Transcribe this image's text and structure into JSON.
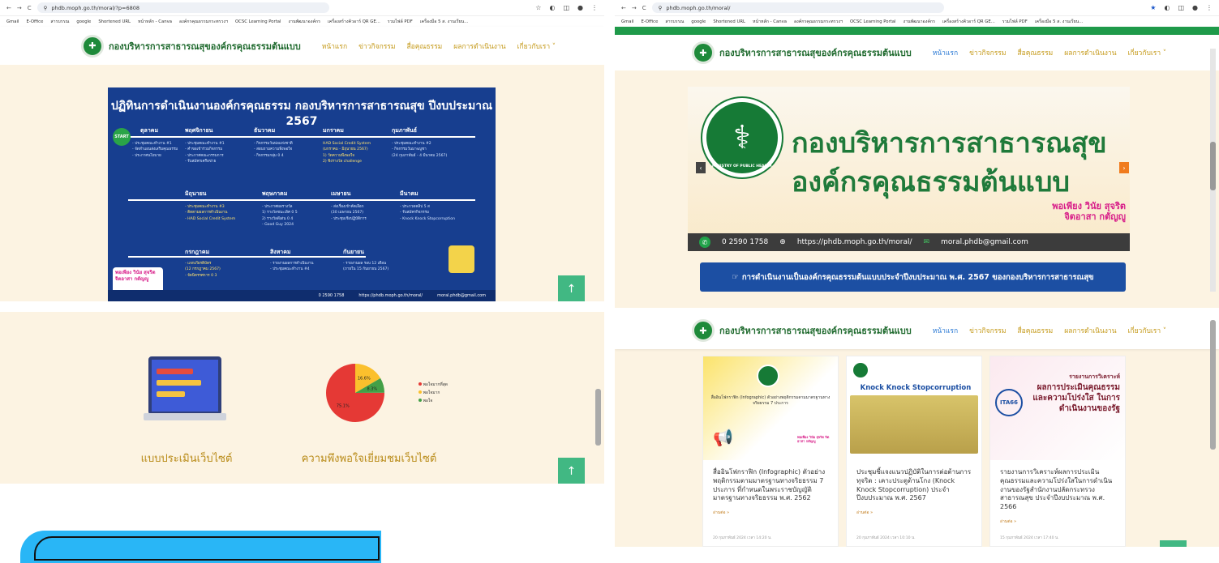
{
  "chrome": {
    "tl_url": "phdb.moph.go.th/moral/?p=6808",
    "tr_url": "phdb.moph.go.th/moral/"
  },
  "bookmarks": [
    "Gmail",
    "E-Office",
    "สารบรรณ",
    "google",
    "Shortened URL",
    "หน้าหลัก - Canva",
    "องค์กรคุณธรรมกระทรวงฯ",
    "OCSC Learning Portal",
    "งานพัฒนาองค์กร",
    "เครื่องสร้างคิวอาร์ QR GE...",
    "รวมไฟล์ PDF",
    "เครื่องมือ 5 ส. งานเรียน..."
  ],
  "brand": "กองบริหารการสาธารณสุของค์กรคุณธรรมต้นแบบ",
  "menu": [
    "หน้าแรก",
    "ข่าวกิจกรรม",
    "สื่อคุณธรรม",
    "ผลการดำเนินงาน",
    "เกี่ยวกับเรา ˅"
  ],
  "poster": {
    "title": "ปฏิทินการดำเนินงานองค์กรคุณธรรม กองบริหารการสาธารณสุข ปีงบประมาณ 2567",
    "start": "START",
    "months": [
      "ตุลาคม",
      "พฤศจิกายน",
      "ธันวาคม",
      "มกราคม",
      "กุมภาพันธ์",
      "มีนาคม",
      "เมษายน",
      "พฤษภาคม",
      "มิถุนายน",
      "สิงหาคม",
      "กรกฎาคม",
      "กันยายน"
    ],
    "lines": [
      "- ประชุมคณะทำงาน #1\n- จัดทำแผนส่งเสริมคุณธรรม\n- ประกาศนโยบาย",
      "- ประชุมคณะทำงาน #1\n- คำขอเข้าร่วมกิจกรรม\n- ประกาศคณะกรรมการ\n- รับสมัครเครือข่าย",
      "- กิจกรรมวันพ่อแห่งชาติ\n- สอบถามความพึงพอใจ\n- กิจกรรมกลุ่ม 0 4",
      "HAD Social Credit System\n(มกราคม - มิถุนายน 2567)\n1) วัดความพึงพอใจ\n2) ชิงรางวัล challenge",
      "- ประชุมคณะทำงาน #2\n- กิจกรรมวันมาฆบูชา\n(24 กุมภาพันธ์ - 4 มีนาคม 2567)",
      "- ประกวดคลิป 5 ส\n- รับสมัครกิจกรรม\n- Knock Knock Stopcorruption",
      "- ส่งเรื่องเข้าคัดเลือก\n(30 เมษายน 2567)\n- ประชุมเชิงปฏิบัติการ",
      "- ประกาศผลรางวัล\n1) รางวัลชนะเลิศ 0 5\n2) รางวัลดีเด่น 0 4\n- Good Guy 2024",
      "- ประชุมคณะทำงาน #3\n- ติดตามผลการดำเนินงาน\n- HAD Social Credit System",
      "- รายงานผลการดำเนินงาน\n- ประชุมคณะทำงาน #4",
      "- แจกเกียรติบัตร\n(12 กรกฎาคม 2567)\n- จัดนิทรรศการ 0 3",
      "- รายงานผล รอบ 12 เดือน\n(ภายใน 15 กันยายน 2567)"
    ],
    "footer_phone": "0 2590 1758",
    "footer_url": "https://phdb.moph.go.th/moral/",
    "footer_email": "moral.phdb@gmail.com"
  },
  "hero": {
    "line1": "กองบริหารการสาธารณสุข",
    "line2": "องค์กรคุณธรรมต้นแบบ",
    "seal_text": "MINISTRY OF PUBLIC HEALTH",
    "slogan": "พอเพียง วินัย สุจริต จิตอาสา กตัญญู",
    "phone": "0 2590 1758",
    "url": "https://phdb.moph.go.th/moral/",
    "email": "moral.phdb@gmail.com"
  },
  "banner": "การดำเนินงานเป็นองค์กรคุณธรรมต้นแบบประจำปีงบประมาณ พ.ศ. 2567 ของกองบริหารการสาธารณสุข",
  "eval": {
    "label": "แบบประเมินเว็บไซต์"
  },
  "satisfaction": {
    "label": "ความพึงพอใจเยี่ยมชมเว็บไซต์"
  },
  "chart_data": {
    "type": "pie",
    "values": [
      75.1,
      16.6,
      8.3
    ],
    "labels": [
      "75.1%",
      "16.6%",
      "8.3%"
    ],
    "legend": [
      "พอใจมากที่สุด",
      "พอใจมาก",
      "พอใจ"
    ],
    "colors": [
      "#e53935",
      "#fbc02d",
      "#43a047"
    ],
    "legend_position": "right"
  },
  "cards": [
    {
      "title": "สื่ออินโฟกราฟิก (Infographic) ตัวอย่างพฤติกรรมตามมาตรฐานทางจริยธรรม 7 ประการ ที่กำหนดในพระราชบัญญัติมาตรฐานทางจริยธรรม พ.ศ. 2562",
      "more": "อ่านต่อ »",
      "date": "20 กุมภาพันธ์ 2024 เวลา 14:20 น.",
      "img_text": "สื่ออินโฟกราฟิก (Infographic) ตัวอย่างพฤติกรรมตามมาตรฐานทางจริยธรรม 7 ประการ"
    },
    {
      "title": "ประชุมชี้แจงแนวปฏิบัติในการต่อต้านการทุจริต : เคาะประตูต้านโกง (Knock Knock Stopcorruption) ประจำปีงบประมาณ พ.ศ. 2567",
      "more": "อ่านต่อ »",
      "date": "20 กุมภาพันธ์ 2024 เวลา 10:10 น.",
      "img_text": "Knock Knock Stopcorruption"
    },
    {
      "title": "รายงานการวิเคราะห์ผลการประเมินคุณธรรมและความโปร่งใสในการดำเนินงานของรัฐสำนักงานปลัดกระทรวงสาธารณสุข ประจำปีงบประมาณ พ.ศ. 2566",
      "more": "อ่านต่อ »",
      "date": "15 กุมภาพันธ์ 2024 เวลา 17:40 น.",
      "img_text": "ผลการประเมินคุณธรรม และความโปร่งใส ในการดำเนินงานของรัฐ",
      "img_head": "รายงานการวิเคราะห์",
      "ita": "ITA66"
    }
  ]
}
